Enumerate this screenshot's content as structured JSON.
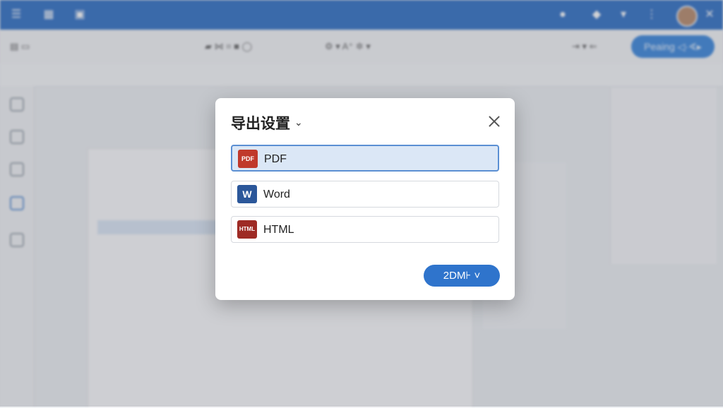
{
  "dialog": {
    "title": "导出设置",
    "options": [
      {
        "label": "PDF",
        "icon": "pdf-icon",
        "icon_text": "PDF",
        "selected": true
      },
      {
        "label": "Word",
        "icon": "word-icon",
        "icon_text": "W"
      },
      {
        "label": "HTML",
        "icon": "html-icon",
        "icon_text": "HTML"
      }
    ],
    "export_button": "2DM⊦ ˅"
  },
  "header": {
    "primary_button": "Peaing ◁·∢▸"
  },
  "colors": {
    "accent": "#2f74cc",
    "titlebar": "#2f6fc4",
    "selected_bg": "#dbe7f6"
  }
}
